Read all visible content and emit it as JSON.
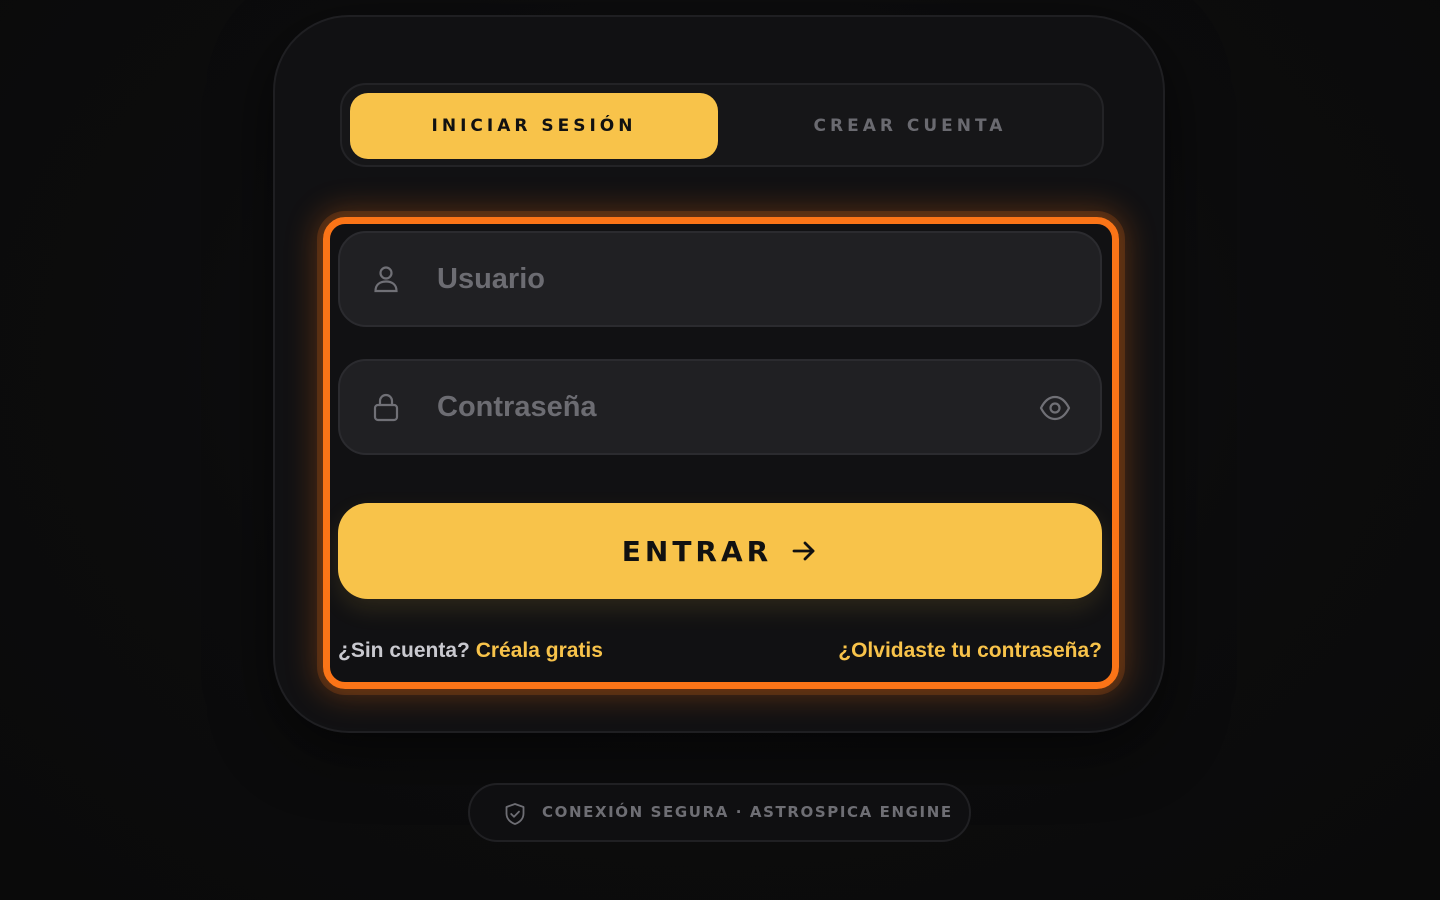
{
  "tabs": {
    "login": "INICIAR SESIÓN",
    "register": "CREAR CUENTA",
    "active": "login"
  },
  "form": {
    "username": {
      "placeholder": "Usuario",
      "value": "",
      "icon": "user-icon"
    },
    "password": {
      "placeholder": "Contraseña",
      "value": "",
      "icon": "lock-icon",
      "toggle_icon": "eye-icon"
    },
    "submit": {
      "label": "ENTRAR",
      "icon": "arrow-right-icon"
    }
  },
  "links": {
    "no_account_prompt": "¿Sin cuenta?",
    "create_free": "Créala gratis",
    "forgot_password": "¿Olvidaste tu contraseña?"
  },
  "footer_badge": {
    "text": "CONEXIÓN SEGURA · ASTROSPICA ENGINE",
    "icon": "shield-check-icon"
  },
  "colors": {
    "accent": "#f8c34a",
    "highlight_frame": "#fb7417",
    "background": "#0c0c0d",
    "card": "#111113",
    "field": "#202023"
  }
}
